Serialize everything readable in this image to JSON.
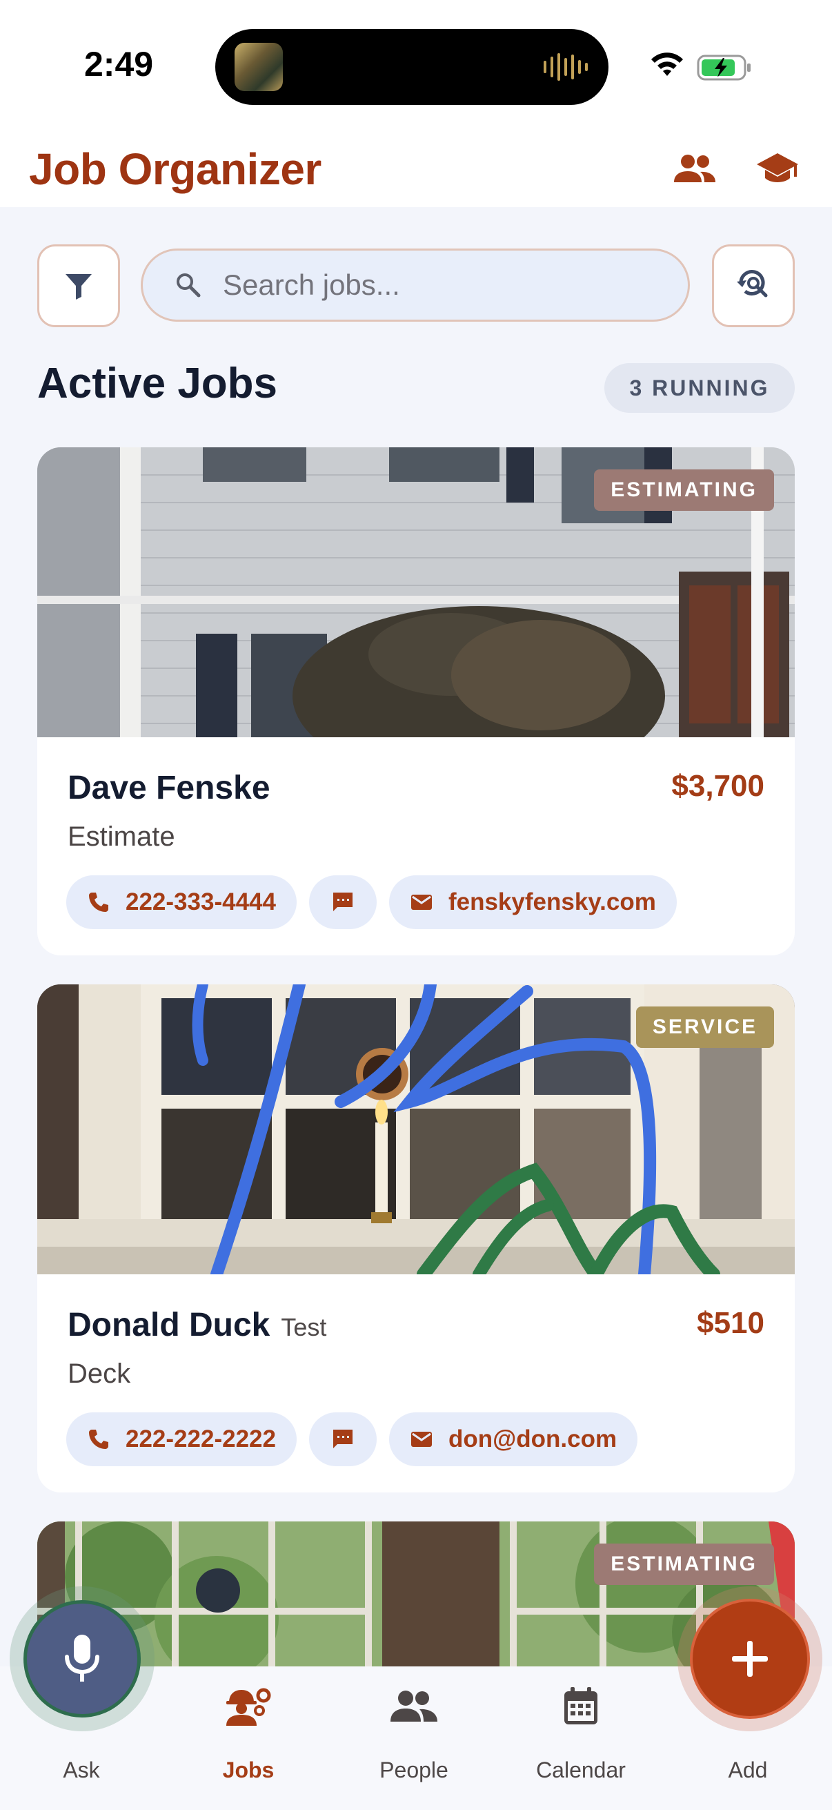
{
  "status": {
    "time": "2:49"
  },
  "header": {
    "title": "Job Organizer",
    "icons": [
      "people-icon",
      "school-icon"
    ]
  },
  "toolbar": {
    "search_placeholder": "Search jobs..."
  },
  "section": {
    "title": "Active Jobs",
    "running_badge": "3 RUNNING"
  },
  "jobs": [
    {
      "stage": "ESTIMATING",
      "name": "Dave Fenske",
      "subtitle": "",
      "price": "$3,700",
      "type": "Estimate",
      "phone": "222-333-4444",
      "email": "fenskyfensky.com"
    },
    {
      "stage": "SERVICE",
      "name": "Donald Duck",
      "subtitle": "Test",
      "price": "$510",
      "type": "Deck",
      "phone": "222-222-2222",
      "email": "don@don.com"
    },
    {
      "stage": "ESTIMATING"
    }
  ],
  "nav": {
    "ask": "Ask",
    "jobs": "Jobs",
    "people": "People",
    "calendar": "Calendar",
    "add": "Add",
    "active": "jobs"
  },
  "colors": {
    "brand": "#9e3412",
    "accent": "#a53d16",
    "estimating_badge": "#9c7a74",
    "service_badge": "#a9945a",
    "mic_fab": "#4f5d85"
  }
}
